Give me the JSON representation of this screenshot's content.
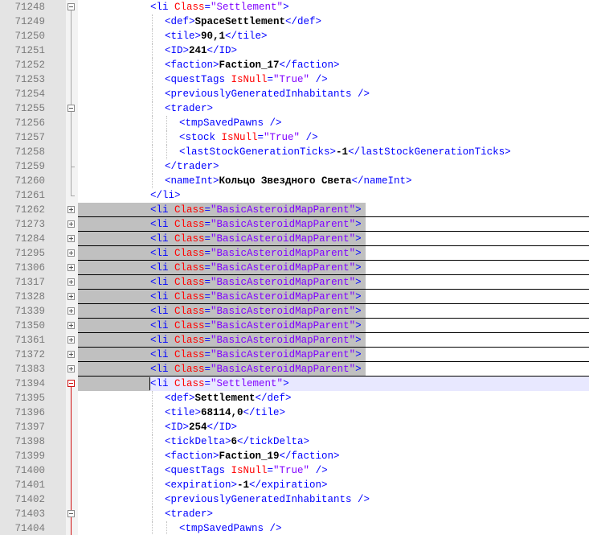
{
  "editor": {
    "colors": {
      "tag": "#0000ff",
      "attr": "#ff0000",
      "value": "#8000ff",
      "text": "#000000",
      "folded_highlight": "#c0c0c0",
      "current_line": "#e8e8ff",
      "gutter": "#e4e4e4"
    },
    "lines": [
      {
        "n": "71248",
        "indent": 0,
        "fold": "minus",
        "tokens": [
          [
            "t",
            "<li "
          ],
          [
            "a",
            "Class"
          ],
          [
            "t",
            "="
          ],
          [
            "v",
            "\"Settlement\""
          ],
          [
            "t",
            ">"
          ]
        ]
      },
      {
        "n": "71249",
        "indent": 1,
        "fold": null,
        "tokens": [
          [
            "t",
            "<def>"
          ],
          [
            "b",
            "SpaceSettlement"
          ],
          [
            "t",
            "</def>"
          ]
        ]
      },
      {
        "n": "71250",
        "indent": 1,
        "fold": null,
        "tokens": [
          [
            "t",
            "<tile>"
          ],
          [
            "b",
            "90,1"
          ],
          [
            "t",
            "</tile>"
          ]
        ]
      },
      {
        "n": "71251",
        "indent": 1,
        "fold": null,
        "tokens": [
          [
            "t",
            "<ID>"
          ],
          [
            "b",
            "241"
          ],
          [
            "t",
            "</ID>"
          ]
        ]
      },
      {
        "n": "71252",
        "indent": 1,
        "fold": null,
        "tokens": [
          [
            "t",
            "<faction>"
          ],
          [
            "b",
            "Faction_17"
          ],
          [
            "t",
            "</faction>"
          ]
        ]
      },
      {
        "n": "71253",
        "indent": 1,
        "fold": null,
        "tokens": [
          [
            "t",
            "<questTags "
          ],
          [
            "a",
            "IsNull"
          ],
          [
            "t",
            "="
          ],
          [
            "v",
            "\"True\""
          ],
          [
            "t",
            " />"
          ]
        ]
      },
      {
        "n": "71254",
        "indent": 1,
        "fold": null,
        "tokens": [
          [
            "t",
            "<previouslyGeneratedInhabitants />"
          ]
        ]
      },
      {
        "n": "71255",
        "indent": 1,
        "fold": "minus",
        "tokens": [
          [
            "t",
            "<trader>"
          ]
        ]
      },
      {
        "n": "71256",
        "indent": 2,
        "fold": null,
        "tokens": [
          [
            "t",
            "<tmpSavedPawns />"
          ]
        ]
      },
      {
        "n": "71257",
        "indent": 2,
        "fold": null,
        "tokens": [
          [
            "t",
            "<stock "
          ],
          [
            "a",
            "IsNull"
          ],
          [
            "t",
            "="
          ],
          [
            "v",
            "\"True\""
          ],
          [
            "t",
            " />"
          ]
        ]
      },
      {
        "n": "71258",
        "indent": 2,
        "fold": null,
        "tokens": [
          [
            "t",
            "<lastStockGenerationTicks>"
          ],
          [
            "b",
            "-1"
          ],
          [
            "t",
            "</lastStockGenerationTicks>"
          ]
        ]
      },
      {
        "n": "71259",
        "indent": 1,
        "fold": "end",
        "tokens": [
          [
            "t",
            "</trader>"
          ]
        ]
      },
      {
        "n": "71260",
        "indent": 1,
        "fold": null,
        "tokens": [
          [
            "t",
            "<nameInt>"
          ],
          [
            "b",
            "Кольцо Звездного Света"
          ],
          [
            "t",
            "</nameInt>"
          ]
        ]
      },
      {
        "n": "71261",
        "indent": 0,
        "fold": "end",
        "tokens": [
          [
            "t",
            "</li>"
          ]
        ]
      },
      {
        "n": "71262",
        "indent": 0,
        "fold": "plus",
        "folded": true,
        "tokens": [
          [
            "t",
            "<li "
          ],
          [
            "a",
            "Class"
          ],
          [
            "t",
            "="
          ],
          [
            "v",
            "\"BasicAsteroidMapParent\""
          ],
          [
            "t",
            ">"
          ]
        ]
      },
      {
        "n": "71273",
        "indent": 0,
        "fold": "plus",
        "folded": true,
        "tokens": [
          [
            "t",
            "<li "
          ],
          [
            "a",
            "Class"
          ],
          [
            "t",
            "="
          ],
          [
            "v",
            "\"BasicAsteroidMapParent\""
          ],
          [
            "t",
            ">"
          ]
        ]
      },
      {
        "n": "71284",
        "indent": 0,
        "fold": "plus",
        "folded": true,
        "tokens": [
          [
            "t",
            "<li "
          ],
          [
            "a",
            "Class"
          ],
          [
            "t",
            "="
          ],
          [
            "v",
            "\"BasicAsteroidMapParent\""
          ],
          [
            "t",
            ">"
          ]
        ]
      },
      {
        "n": "71295",
        "indent": 0,
        "fold": "plus",
        "folded": true,
        "tokens": [
          [
            "t",
            "<li "
          ],
          [
            "a",
            "Class"
          ],
          [
            "t",
            "="
          ],
          [
            "v",
            "\"BasicAsteroidMapParent\""
          ],
          [
            "t",
            ">"
          ]
        ]
      },
      {
        "n": "71306",
        "indent": 0,
        "fold": "plus",
        "folded": true,
        "tokens": [
          [
            "t",
            "<li "
          ],
          [
            "a",
            "Class"
          ],
          [
            "t",
            "="
          ],
          [
            "v",
            "\"BasicAsteroidMapParent\""
          ],
          [
            "t",
            ">"
          ]
        ]
      },
      {
        "n": "71317",
        "indent": 0,
        "fold": "plus",
        "folded": true,
        "tokens": [
          [
            "t",
            "<li "
          ],
          [
            "a",
            "Class"
          ],
          [
            "t",
            "="
          ],
          [
            "v",
            "\"BasicAsteroidMapParent\""
          ],
          [
            "t",
            ">"
          ]
        ]
      },
      {
        "n": "71328",
        "indent": 0,
        "fold": "plus",
        "folded": true,
        "tokens": [
          [
            "t",
            "<li "
          ],
          [
            "a",
            "Class"
          ],
          [
            "t",
            "="
          ],
          [
            "v",
            "\"BasicAsteroidMapParent\""
          ],
          [
            "t",
            ">"
          ]
        ]
      },
      {
        "n": "71339",
        "indent": 0,
        "fold": "plus",
        "folded": true,
        "tokens": [
          [
            "t",
            "<li "
          ],
          [
            "a",
            "Class"
          ],
          [
            "t",
            "="
          ],
          [
            "v",
            "\"BasicAsteroidMapParent\""
          ],
          [
            "t",
            ">"
          ]
        ]
      },
      {
        "n": "71350",
        "indent": 0,
        "fold": "plus",
        "folded": true,
        "tokens": [
          [
            "t",
            "<li "
          ],
          [
            "a",
            "Class"
          ],
          [
            "t",
            "="
          ],
          [
            "v",
            "\"BasicAsteroidMapParent\""
          ],
          [
            "t",
            ">"
          ]
        ]
      },
      {
        "n": "71361",
        "indent": 0,
        "fold": "plus",
        "folded": true,
        "tokens": [
          [
            "t",
            "<li "
          ],
          [
            "a",
            "Class"
          ],
          [
            "t",
            "="
          ],
          [
            "v",
            "\"BasicAsteroidMapParent\""
          ],
          [
            "t",
            ">"
          ]
        ]
      },
      {
        "n": "71372",
        "indent": 0,
        "fold": "plus",
        "folded": true,
        "tokens": [
          [
            "t",
            "<li "
          ],
          [
            "a",
            "Class"
          ],
          [
            "t",
            "="
          ],
          [
            "v",
            "\"BasicAsteroidMapParent\""
          ],
          [
            "t",
            ">"
          ]
        ]
      },
      {
        "n": "71383",
        "indent": 0,
        "fold": "plus",
        "folded": true,
        "tokens": [
          [
            "t",
            "<li "
          ],
          [
            "a",
            "Class"
          ],
          [
            "t",
            "="
          ],
          [
            "v",
            "\"BasicAsteroidMapParent\""
          ],
          [
            "t",
            ">"
          ]
        ]
      },
      {
        "n": "71394",
        "indent": 0,
        "fold": "minus-red",
        "current": true,
        "tokens": [
          [
            "t",
            "<li "
          ],
          [
            "a",
            "Class"
          ],
          [
            "t",
            "="
          ],
          [
            "v",
            "\"Settlement\""
          ],
          [
            "t",
            ">"
          ]
        ]
      },
      {
        "n": "71395",
        "indent": 1,
        "fold": null,
        "tokens": [
          [
            "t",
            "<def>"
          ],
          [
            "b",
            "Settlement"
          ],
          [
            "t",
            "</def>"
          ]
        ]
      },
      {
        "n": "71396",
        "indent": 1,
        "fold": null,
        "tokens": [
          [
            "t",
            "<tile>"
          ],
          [
            "b",
            "68114,0"
          ],
          [
            "t",
            "</tile>"
          ]
        ]
      },
      {
        "n": "71397",
        "indent": 1,
        "fold": null,
        "tokens": [
          [
            "t",
            "<ID>"
          ],
          [
            "b",
            "254"
          ],
          [
            "t",
            "</ID>"
          ]
        ]
      },
      {
        "n": "71398",
        "indent": 1,
        "fold": null,
        "tokens": [
          [
            "t",
            "<tickDelta>"
          ],
          [
            "b",
            "6"
          ],
          [
            "t",
            "</tickDelta>"
          ]
        ]
      },
      {
        "n": "71399",
        "indent": 1,
        "fold": null,
        "tokens": [
          [
            "t",
            "<faction>"
          ],
          [
            "b",
            "Faction_19"
          ],
          [
            "t",
            "</faction>"
          ]
        ]
      },
      {
        "n": "71400",
        "indent": 1,
        "fold": null,
        "tokens": [
          [
            "t",
            "<questTags "
          ],
          [
            "a",
            "IsNull"
          ],
          [
            "t",
            "="
          ],
          [
            "v",
            "\"True\""
          ],
          [
            "t",
            " />"
          ]
        ]
      },
      {
        "n": "71401",
        "indent": 1,
        "fold": null,
        "tokens": [
          [
            "t",
            "<expiration>"
          ],
          [
            "b",
            "-1"
          ],
          [
            "t",
            "</expiration>"
          ]
        ]
      },
      {
        "n": "71402",
        "indent": 1,
        "fold": null,
        "tokens": [
          [
            "t",
            "<previouslyGeneratedInhabitants />"
          ]
        ]
      },
      {
        "n": "71403",
        "indent": 1,
        "fold": "minus",
        "tokens": [
          [
            "t",
            "<trader>"
          ]
        ]
      },
      {
        "n": "71404",
        "indent": 2,
        "fold": null,
        "tokens": [
          [
            "t",
            "<tmpSavedPawns />"
          ]
        ]
      }
    ]
  }
}
